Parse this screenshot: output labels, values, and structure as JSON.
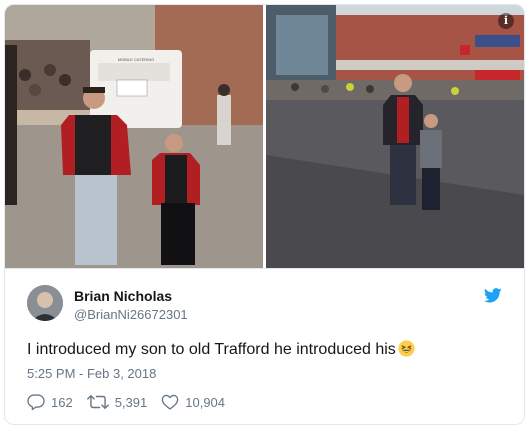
{
  "media": {
    "left_photo_sign": "MOBILE CATERING",
    "info_icon": "info-icon"
  },
  "author": {
    "name": "Brian Nicholas",
    "handle": "@BrianNi26672301"
  },
  "tweet": {
    "text": "I introduced my son to old Trafford he introduced his",
    "emoji": "grinning-squinting-face-emoji",
    "timestamp": "5:25 PM - Feb 3, 2018"
  },
  "stats": {
    "replies": "162",
    "retweets": "5,391",
    "likes": "10,904"
  },
  "colors": {
    "twitter_blue": "#1da1f2",
    "secondary_text": "#657786",
    "primary_text": "#14171a"
  }
}
